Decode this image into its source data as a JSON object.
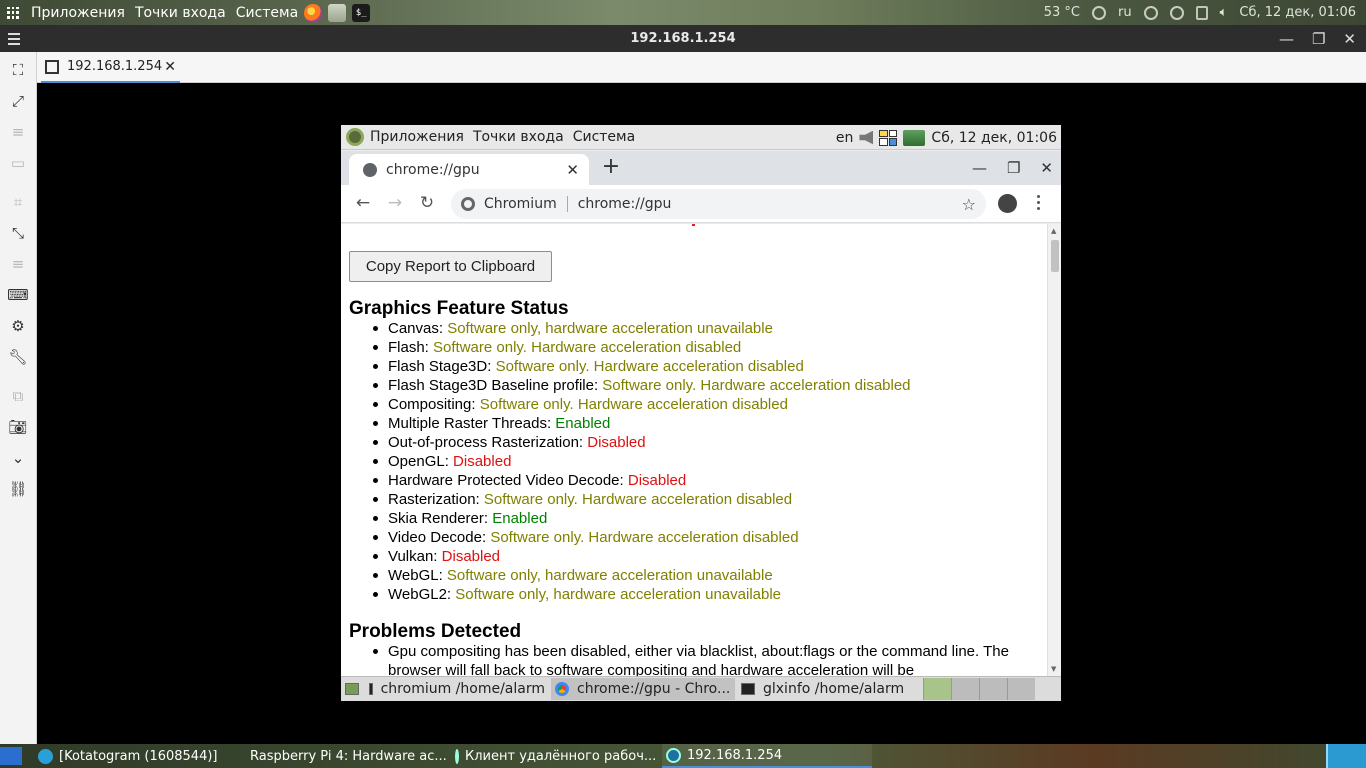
{
  "host_panel": {
    "menu": [
      "Приложения",
      "Точки входа",
      "Система"
    ],
    "temperature": "53 °C",
    "lang": "ru",
    "clock": "Сб, 12 дек, 01:06"
  },
  "remmina": {
    "title": "192.168.1.254",
    "tab_label": "192.168.1.254"
  },
  "remote_panel": {
    "menu": [
      "Приложения",
      "Точки входа",
      "Система"
    ],
    "lang": "en",
    "clock": "Сб, 12 дек, 01:06"
  },
  "chromium": {
    "tab_title": "chrome://gpu",
    "omnibox_brand": "Chromium",
    "omnibox_url": "chrome://gpu",
    "copy_button": "Copy Report to Clipboard",
    "section_features": "Graphics Feature Status",
    "features": [
      {
        "name": "Canvas:",
        "status": "Software only, hardware acceleration unavailable"
      },
      {
        "name": "Flash:",
        "status": "Software only. Hardware acceleration disabled"
      },
      {
        "name": "Flash Stage3D:",
        "status": "Software only. Hardware acceleration disabled"
      },
      {
        "name": "Flash Stage3D Baseline profile:",
        "status": "Software only. Hardware acceleration disabled"
      },
      {
        "name": "Compositing:",
        "status": "Software only. Hardware acceleration disabled"
      },
      {
        "name": "Multiple Raster Threads:",
        "status": "Enabled"
      },
      {
        "name": "Out-of-process Rasterization:",
        "status": "Disabled"
      },
      {
        "name": "OpenGL:",
        "status": "Disabled"
      },
      {
        "name": "Hardware Protected Video Decode:",
        "status": "Disabled"
      },
      {
        "name": "Rasterization:",
        "status": "Software only. Hardware acceleration disabled"
      },
      {
        "name": "Skia Renderer:",
        "status": "Enabled"
      },
      {
        "name": "Video Decode:",
        "status": "Software only. Hardware acceleration disabled"
      },
      {
        "name": "Vulkan:",
        "status": "Disabled"
      },
      {
        "name": "WebGL:",
        "status": "Software only, hardware acceleration unavailable"
      },
      {
        "name": "WebGL2:",
        "status": "Software only, hardware acceleration unavailable"
      }
    ],
    "section_problems": "Problems Detected",
    "problems": [
      "Gpu compositing has been disabled, either via blacklist, about:flags or the command line. The browser will fall back to software compositing and hardware acceleration will be"
    ],
    "status_colors": {
      "software": "#808000",
      "enabled": "#008000",
      "disabled": "#e01010"
    }
  },
  "remote_taskbar": {
    "items": [
      "chromium /home/alarm",
      "chrome://gpu - Chro...",
      "glxinfo /home/alarm"
    ]
  },
  "host_taskbar": {
    "items": [
      "[Kotatogram (1608544)]",
      "Raspberry Pi 4: Hardware ac...",
      "Клиент удалённого рабоч...",
      "192.168.1.254"
    ]
  }
}
